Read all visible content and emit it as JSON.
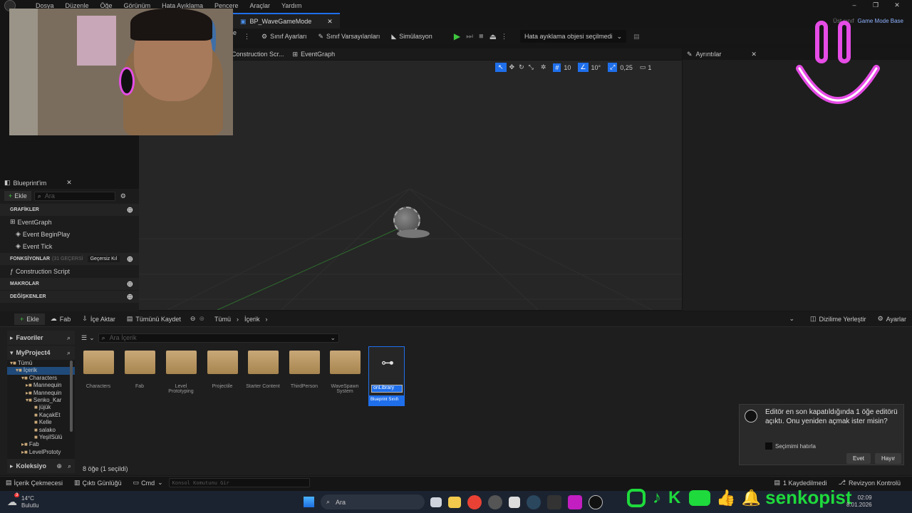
{
  "menu": [
    "Dosya",
    "Düzenle",
    "Öğe",
    "Görünüm",
    "Hata Ayıklama",
    "Pencere",
    "Araçlar",
    "Yardım"
  ],
  "tab": {
    "title": "BP_WaveGameMode"
  },
  "parent": {
    "label": "Üst sınıf",
    "value": "Game Mode Base"
  },
  "toolbar": {
    "partial": "e",
    "class_settings": "Sınıf Ayarları",
    "class_defaults": "Sınıf Varsayılanları",
    "simulation": "Simülasyon",
    "debug": "Hata ayıklama objesi seçilmedi"
  },
  "graph_tabs": {
    "construction": "Construction Scr...",
    "event": "EventGraph"
  },
  "graph_tools": {
    "grid": "10",
    "angle": "10°",
    "scale": "0,25",
    "cams": "1"
  },
  "details": {
    "title": "Ayrıntılar"
  },
  "myblueprint": {
    "title": "Blueprint'im",
    "add": "Ekle",
    "search": "Ara",
    "graphs": "GRAFİKLER",
    "eventgraph": "EventGraph",
    "beginplay": "Event BeginPlay",
    "tick": "Event Tick",
    "functions": "FONKSİYONLAR",
    "functions_hidden": "(31 GEÇERSİ",
    "override": "Geçersiz Kıl",
    "construction": "Construction Script",
    "macros": "MAKROLAR",
    "variables": "DEĞİŞKENLER"
  },
  "content": {
    "add": "Ekle",
    "fab": "Fab",
    "import": "İçe Aktar",
    "save_all": "Tümünü Kaydet",
    "crumb1": "Tümü",
    "crumb2": "İçerik",
    "dock": "Dizilime Yerleştir",
    "settings": "Ayarlar",
    "favorites": "Favoriler",
    "project": "MyProject4",
    "search": "Ara İçerik",
    "collections": "Koleksiyo",
    "count": "8 öğe (1 seçildi)"
  },
  "tree": [
    "Tümü",
    "İçerik",
    "Characters",
    "Mannequin",
    "Mannequin",
    "Senko_Kar",
    "jüjük",
    "KaçakEt",
    "Kelle",
    "salako",
    "YeşilSülü",
    "Fab",
    "LevelPrototy"
  ],
  "assets": [
    {
      "name": "Characters"
    },
    {
      "name": "Fab"
    },
    {
      "name": "Level Prototyping"
    },
    {
      "name": "Projectile"
    },
    {
      "name": "Starter Content"
    },
    {
      "name": "ThirdPerson"
    },
    {
      "name": "WaveSpawn System"
    }
  ],
  "selected_asset": {
    "rename": "onLibrary",
    "type": "Blueprint Sınıfı"
  },
  "notif": {
    "text": "Editör en son kapatıldığında 1 öğe editörü açıktı. Onu yeniden açmak ister misin?",
    "remember": "Seçimimi hatırla",
    "yes": "Evet",
    "no": "Hayır"
  },
  "status": {
    "drawer": "İçerik Çekmecesi",
    "log": "Çıktı Günlüğü",
    "cmd": "Cmd",
    "console": "Konsol Komutunu Gir",
    "saved": "1 Kaydedilmedi",
    "revision": "Revizyon Kontrolü"
  },
  "taskbar": {
    "temp": "14°C",
    "weather": "Bulutlu",
    "search": "Ara",
    "time": "02:09",
    "date": "8.01.2026",
    "badge": "3"
  },
  "stream": {
    "handle": "senkopist"
  },
  "colors": {
    "accent": "#1f6feb",
    "logo": "#e64ce6",
    "brand": "#1eda3c"
  }
}
